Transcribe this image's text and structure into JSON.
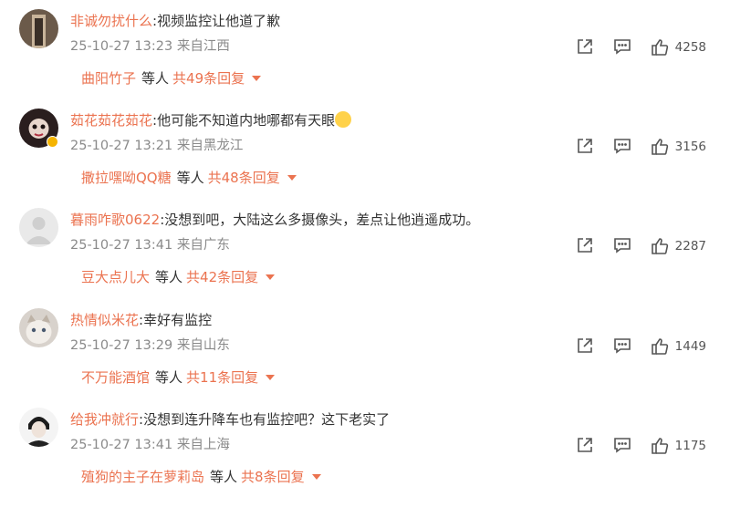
{
  "comments": [
    {
      "username": "非诚勿扰什么",
      "text": "视频监控让他道了歉",
      "time": "25-10-27 13:23",
      "location": "来自江西",
      "likes": "4258",
      "replier": "曲阳竹子",
      "etc": "等人",
      "reply_count": "共49条回复"
    },
    {
      "username": "茹花茹花茹花",
      "text": "他可能不知道内地哪都有天眼",
      "time": "25-10-27 13:21",
      "location": "来自黑龙江",
      "likes": "3156",
      "replier": "撒拉嘿呦QQ糖",
      "etc": "等人",
      "reply_count": "共48条回复"
    },
    {
      "username": "暮雨咋歌0622",
      "text": "没想到吧，大陆这么多摄像头，差点让他逍遥成功。",
      "time": "25-10-27 13:41",
      "location": "来自广东",
      "likes": "2287",
      "replier": "豆大点儿大",
      "etc": "等人",
      "reply_count": "共42条回复"
    },
    {
      "username": "热情似米花",
      "text": "幸好有监控",
      "time": "25-10-27 13:29",
      "location": "来自山东",
      "likes": "1449",
      "replier": "不万能酒馆",
      "etc": "等人",
      "reply_count": "共11条回复"
    },
    {
      "username": "给我冲就行",
      "text": "没想到连升降车也有监控吧？这下老实了",
      "time": "25-10-27 13:41",
      "location": "来自上海",
      "likes": "1175",
      "replier": "殖狗的主子在萝莉岛",
      "etc": "等人",
      "reply_count": "共8条回复"
    }
  ],
  "colors": {
    "username": "#eb7350",
    "text": "#333333",
    "meta": "#8a8a8a",
    "icon": "#555555"
  },
  "icons": [
    "share-icon",
    "comment-icon",
    "like-icon",
    "caret-down-icon"
  ]
}
